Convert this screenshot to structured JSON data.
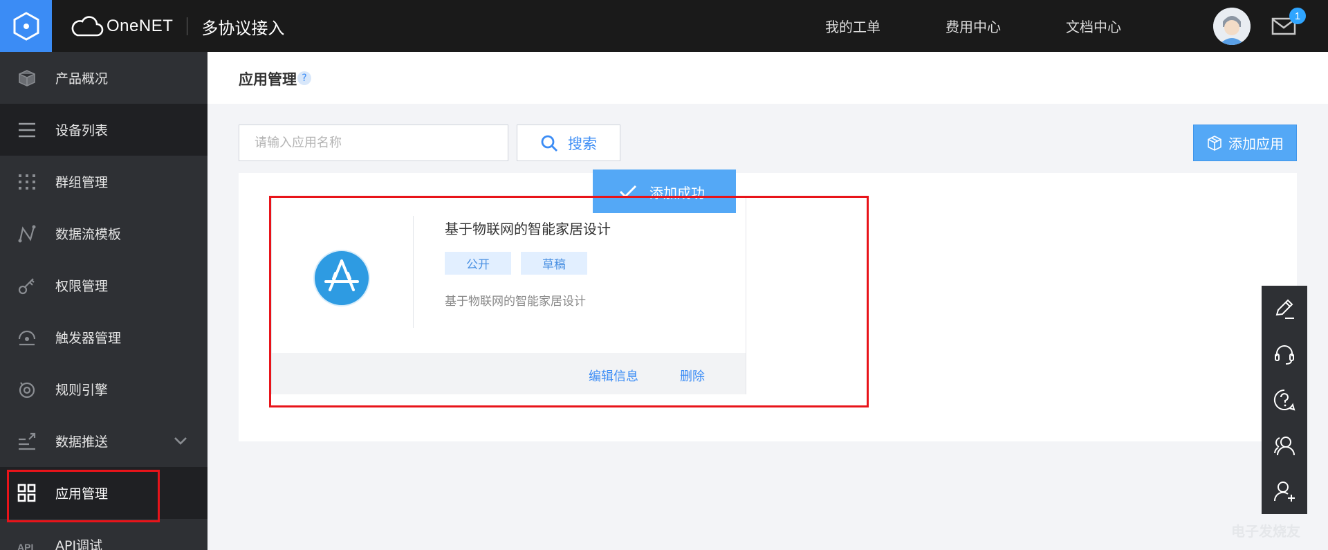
{
  "header": {
    "brand_name": "OneNET",
    "brand_subtitle": "多协议接入",
    "nav": [
      "我的工单",
      "费用中心",
      "文档中心"
    ],
    "unread_count": "1"
  },
  "sidebar": {
    "items": [
      {
        "label": "产品概况",
        "icon": "cube-icon"
      },
      {
        "label": "设备列表",
        "icon": "list-icon"
      },
      {
        "label": "群组管理",
        "icon": "grid-dots-icon"
      },
      {
        "label": "数据流模板",
        "icon": "flow-icon"
      },
      {
        "label": "权限管理",
        "icon": "key-icon"
      },
      {
        "label": "触发器管理",
        "icon": "trigger-icon"
      },
      {
        "label": "规则引擎",
        "icon": "engine-icon"
      },
      {
        "label": "数据推送",
        "icon": "push-icon"
      },
      {
        "label": "应用管理",
        "icon": "apps-icon",
        "active": true
      },
      {
        "label": "API调试",
        "icon": "api-icon"
      }
    ]
  },
  "page": {
    "title": "应用管理",
    "help_symbol": "?"
  },
  "search": {
    "placeholder": "请输入应用名称",
    "button_label": "搜索"
  },
  "add_button_label": "添加应用",
  "toast": {
    "message": "添加成功"
  },
  "app_card": {
    "title": "基于物联网的智能家居设计",
    "tags": [
      "公开",
      "草稿"
    ],
    "description": "基于物联网的智能家居设计",
    "actions": [
      "编辑信息",
      "删除"
    ]
  },
  "tools": [
    "edit-icon",
    "headset-icon",
    "question-icon",
    "community-icon",
    "add-user-icon"
  ],
  "watermark": "电子发烧友",
  "colors": {
    "accent": "#3b8cf5",
    "highlight": "#e8141a",
    "topbar": "#1a1a1a",
    "sidebar": "#2e3034"
  }
}
